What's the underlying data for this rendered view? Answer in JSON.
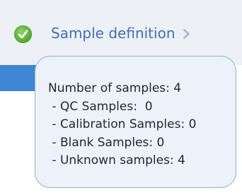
{
  "step": {
    "label": "Sample definition",
    "status_icon": "check-circle-icon",
    "chevron_icon": "chevron-right-icon",
    "status_color": "#5fb13d",
    "link_color": "#3e71b6"
  },
  "tooltip": {
    "summary": "Number of samples: 4",
    "lines": [
      " - QC Samples:  0",
      " - Calibration Samples: 0",
      " - Blank Samples: 0",
      " - Unknown samples: 4"
    ]
  },
  "colors": {
    "header_bg": "#edf0f4",
    "selected_bar": "#3f86d2",
    "tooltip_bg": "#edf2f9",
    "tooltip_border": "#8caed3"
  }
}
